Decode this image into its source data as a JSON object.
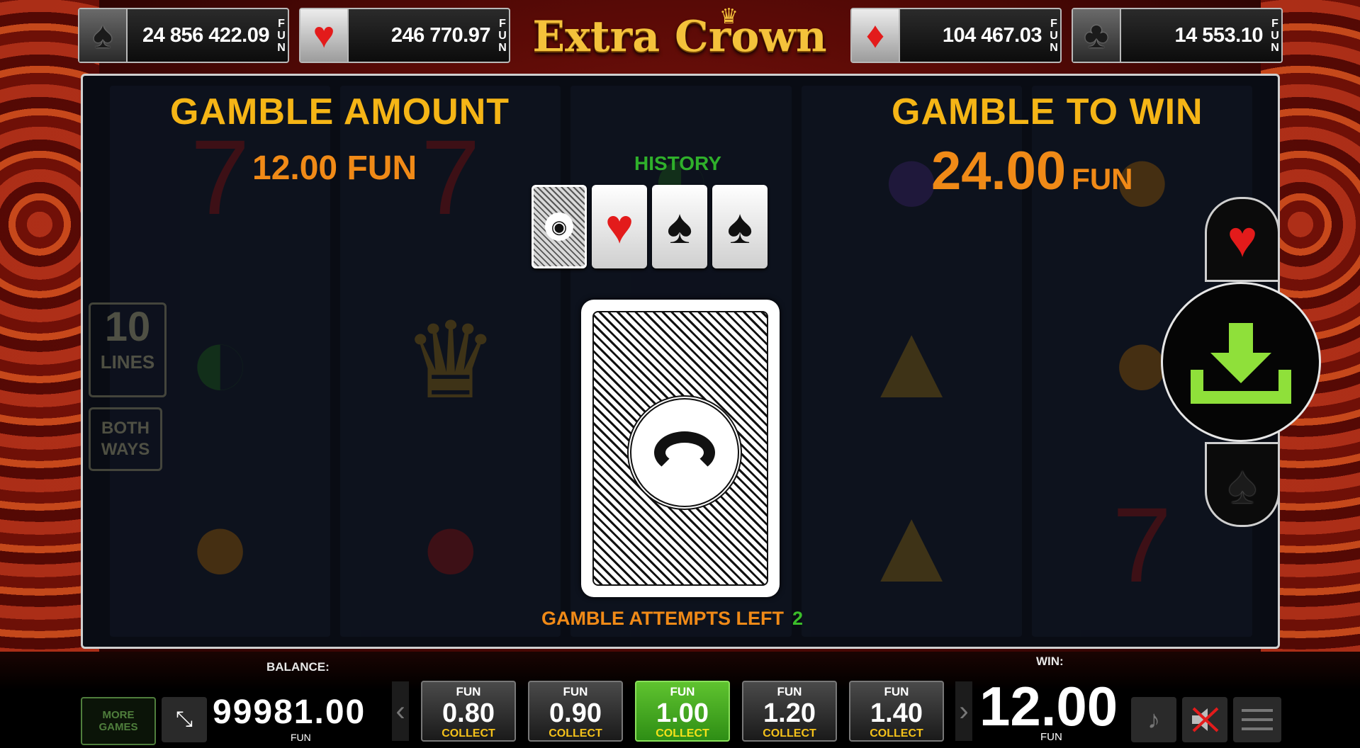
{
  "title": "Extra Crown",
  "jackpots": [
    {
      "suit": "spade",
      "glyph": "♠",
      "value": "24 856 422.09",
      "currency": [
        "F",
        "U",
        "N"
      ]
    },
    {
      "suit": "heart",
      "glyph": "♥",
      "value": "246 770.97",
      "currency": [
        "F",
        "U",
        "N"
      ]
    },
    {
      "suit": "diamond",
      "glyph": "♦",
      "value": "104 467.03",
      "currency": [
        "F",
        "U",
        "N"
      ]
    },
    {
      "suit": "club",
      "glyph": "♣",
      "value": "14 553.10",
      "currency": [
        "F",
        "U",
        "N"
      ]
    }
  ],
  "panel": {
    "lines_number": "10",
    "lines_label": "LINES",
    "ways_label_1": "BOTH",
    "ways_label_2": "WAYS"
  },
  "gamble": {
    "amount_title": "GAMBLE AMOUNT",
    "amount_value": "12.00 FUN",
    "win_title": "GAMBLE TO WIN",
    "win_value": "24.00",
    "win_currency": "FUN",
    "history_label": "HISTORY",
    "history": [
      {
        "type": "back",
        "icon": "card-back-icon"
      },
      {
        "type": "heart",
        "glyph": "♥",
        "color": "#e31b1b"
      },
      {
        "type": "spade",
        "glyph": "♠",
        "color": "#111111"
      },
      {
        "type": "spade",
        "glyph": "♠",
        "color": "#111111"
      }
    ],
    "attempts_label": "GAMBLE ATTEMPTS LEFT",
    "attempts_value": "2"
  },
  "controls": {
    "red_glyph": "♥",
    "black_glyph": "♠",
    "collect_icon": "download-icon"
  },
  "bottom": {
    "balance_label": "BALANCE:",
    "balance_value": "99981.00",
    "balance_currency": "FUN",
    "more_games_1": "MORE",
    "more_games_2": "GAMES",
    "bets": [
      {
        "top": "FUN",
        "value": "0.80",
        "action": "COLLECT",
        "selected": false
      },
      {
        "top": "FUN",
        "value": "0.90",
        "action": "COLLECT",
        "selected": false
      },
      {
        "top": "FUN",
        "value": "1.00",
        "action": "COLLECT",
        "selected": true
      },
      {
        "top": "FUN",
        "value": "1.20",
        "action": "COLLECT",
        "selected": false
      },
      {
        "top": "FUN",
        "value": "1.40",
        "action": "COLLECT",
        "selected": false
      }
    ],
    "win_label": "WIN:",
    "win_value": "12.00",
    "win_currency": "FUN"
  },
  "colors": {
    "gold": "#f5b516",
    "orange": "#f08a17",
    "green_accent": "#3bbd2a",
    "collect_green": "#8fe03a"
  }
}
